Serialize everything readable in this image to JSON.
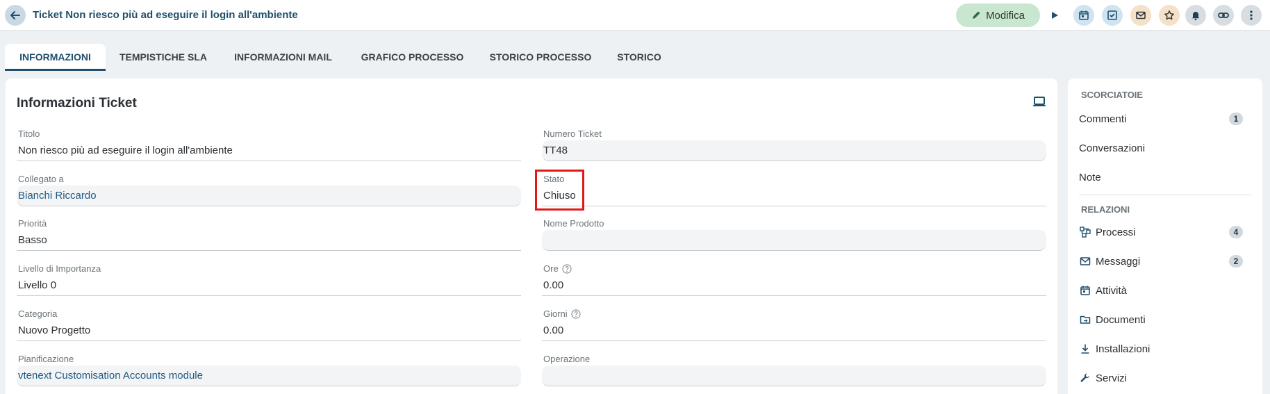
{
  "header": {
    "title": "Ticket Non riesco più ad eseguire il login all'ambiente",
    "edit_label": "Modifica",
    "icons": [
      "back-icon",
      "pencil-icon",
      "play-icon",
      "calendar-icon",
      "checkbox-icon",
      "mail-icon",
      "star-icon",
      "bell-icon",
      "link-icon",
      "more-icon"
    ]
  },
  "tabs": [
    {
      "label": "INFORMAZIONI",
      "active": true
    },
    {
      "label": "TEMPISTICHE SLA"
    },
    {
      "label": "INFORMAZIONI MAIL"
    },
    {
      "label": "GRAFICO PROCESSO"
    },
    {
      "label": "STORICO PROCESSO"
    },
    {
      "label": "STORICO"
    }
  ],
  "card": {
    "title": "Informazioni Ticket",
    "fields_left": [
      {
        "label": "Titolo",
        "value": "Non riesco più ad eseguire il login all'ambiente"
      },
      {
        "label": "Collegato a",
        "value": "Bianchi Riccardo"
      },
      {
        "label": "Priorità",
        "value": "Basso"
      },
      {
        "label": "Livello di Importanza",
        "value": "Livello 0"
      },
      {
        "label": "Categoria",
        "value": "Nuovo Progetto"
      },
      {
        "label": "Pianificazione",
        "value": "vtenext Customisation Accounts module"
      }
    ],
    "fields_right": [
      {
        "label": "Numero Ticket",
        "value": "TT48"
      },
      {
        "label": "Stato",
        "value": "Chiuso"
      },
      {
        "label": "Nome Prodotto",
        "value": ""
      },
      {
        "label": "Ore",
        "value": "0.00"
      },
      {
        "label": "Giorni",
        "value": "0.00"
      },
      {
        "label": "Operazione",
        "value": ""
      }
    ]
  },
  "sidebar": {
    "shortcuts_heading": "SCORCIATOIE",
    "shortcuts": [
      {
        "label": "Commenti",
        "count": "1"
      },
      {
        "label": "Conversazioni"
      },
      {
        "label": "Note"
      }
    ],
    "relations_heading": "RELAZIONI",
    "relations": [
      {
        "label": "Processi",
        "count": "4",
        "icon": "process-icon"
      },
      {
        "label": "Messaggi",
        "count": "2",
        "icon": "mail-icon"
      },
      {
        "label": "Attività",
        "icon": "calendar-icon"
      },
      {
        "label": "Documenti",
        "icon": "folder-icon"
      },
      {
        "label": "Installazioni",
        "icon": "download-icon"
      },
      {
        "label": "Servizi",
        "icon": "wrench-icon"
      }
    ]
  },
  "colors": {
    "accent": "#1f4f6b",
    "edit_button": "#c9e6d0",
    "highlight": "#e01818"
  }
}
